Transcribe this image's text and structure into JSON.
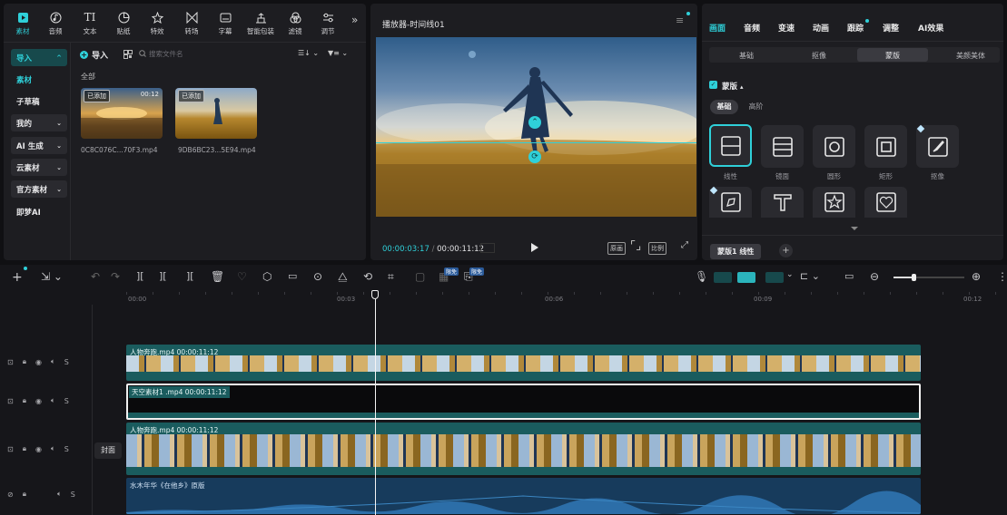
{
  "toolbar": {
    "items": [
      {
        "label": "素材",
        "icon": "media-icon",
        "active": true
      },
      {
        "label": "音频",
        "icon": "audio-icon"
      },
      {
        "label": "文本",
        "icon": "text-icon"
      },
      {
        "label": "贴纸",
        "icon": "sticker-icon"
      },
      {
        "label": "特效",
        "icon": "effects-icon"
      },
      {
        "label": "转场",
        "icon": "transition-icon"
      },
      {
        "label": "字幕",
        "icon": "subtitle-icon"
      },
      {
        "label": "智能包装",
        "icon": "smart-package-icon"
      },
      {
        "label": "滤镜",
        "icon": "filter-icon"
      },
      {
        "label": "调节",
        "icon": "adjust-icon"
      }
    ],
    "more": "»"
  },
  "sidebar": {
    "items": [
      {
        "label": "导入",
        "chev": "^"
      },
      {
        "label": "素材",
        "chev": ""
      },
      {
        "label": "子草稿",
        "chev": ""
      },
      {
        "label": "我的",
        "chev": "⌄"
      },
      {
        "label": "AI 生成",
        "chev": "⌄"
      },
      {
        "label": "云素材",
        "chev": "⌄"
      },
      {
        "label": "官方素材",
        "chev": "⌄"
      },
      {
        "label": "即梦AI",
        "chev": ""
      }
    ]
  },
  "media": {
    "import_label": "导入",
    "search_placeholder": "搜索文件名",
    "section": "全部",
    "files": [
      {
        "name": "0C8C076C...70F3.mp4",
        "tag": "已添加",
        "duration": "00:12"
      },
      {
        "name": "9DB6BC23...5E94.mp4",
        "tag": "已添加",
        "duration": ""
      }
    ]
  },
  "player": {
    "title": "播放器-时间线01",
    "current_time": "00:00:03:17",
    "total_time": "00:00:11:12",
    "btn_original": "原画",
    "btn_ratio": "比例"
  },
  "right": {
    "tabs": [
      "画面",
      "音频",
      "变速",
      "动画",
      "跟踪",
      "调整",
      "AI效果"
    ],
    "subtabs": [
      "基础",
      "抠像",
      "蒙版",
      "美颜美体"
    ],
    "mask_title": "蒙版",
    "mask_modes": [
      "基础",
      "高阶"
    ],
    "masks": [
      "线性",
      "镜面",
      "圆形",
      "矩形",
      "抠像"
    ],
    "footer_tag": "蒙版1 线性",
    "add": "+"
  },
  "timeline": {
    "ruler": [
      "00:00",
      "00:03",
      "00:06",
      "00:09",
      "00:12"
    ],
    "badge1": "限免",
    "badge2": "限免",
    "cover_label": "封面",
    "tracks": [
      {
        "label": "人物奔跑.mp4  00:00:11:12"
      },
      {
        "label": "天空素材1 .mp4  00:00:11:12"
      },
      {
        "label": "人物奔跑.mp4  00:00:11:12"
      },
      {
        "label": "水木年华《在他乡》原版"
      }
    ]
  },
  "colors": {
    "accent": "#2fd0d9",
    "clip": "#1a5c5e",
    "audio": "#173b5c"
  }
}
